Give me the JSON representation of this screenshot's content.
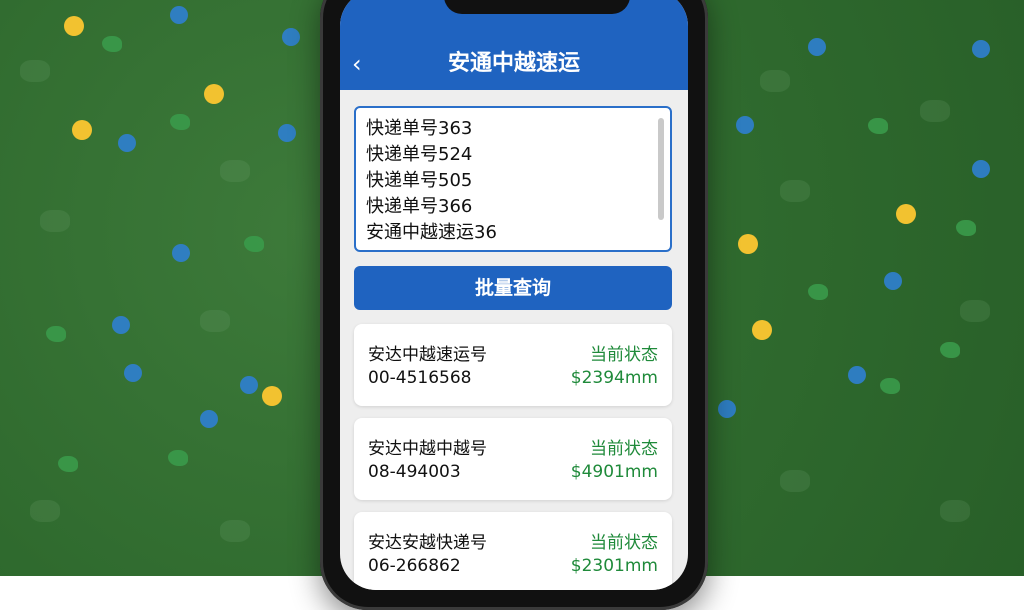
{
  "header": {
    "back_icon": "chevron-left-icon",
    "title": "安通中越速运"
  },
  "query_input": {
    "lines": [
      "快递单号363",
      "快递单号524",
      "快递单号505",
      "快递单号366",
      "安通中越速运36"
    ]
  },
  "batch_button": {
    "label": "批量查询"
  },
  "results": [
    {
      "name": "安达中越速运号",
      "number": "00-4516568",
      "status_label": "当前状态",
      "status_value": "$2394mm"
    },
    {
      "name": "安达中越中越号",
      "number": "08-494003",
      "status_label": "当前状态",
      "status_value": "$4901mm"
    },
    {
      "name": "安达安越快递号",
      "number": "06-266862",
      "status_label": "当前状态",
      "status_value": "$2301mm"
    }
  ],
  "colors": {
    "brand_blue": "#1f63c0",
    "status_green": "#1f8a3a",
    "background_green": "#2f6a2e"
  }
}
